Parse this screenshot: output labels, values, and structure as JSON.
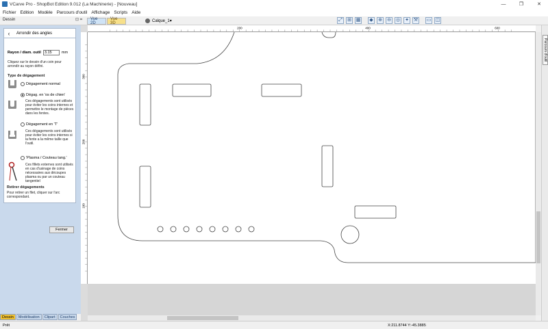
{
  "window": {
    "title": "VCarve Pro - ShopBot Edition 9.012 (La Machinerie) - [Nouveau]",
    "controls": [
      "—",
      "❐",
      "✕"
    ]
  },
  "menu": [
    "Fichier",
    "Edition",
    "Modèle",
    "Parcours d'outil",
    "Affichage",
    "Scripts",
    "Aide"
  ],
  "panel": {
    "header": "Dessin",
    "pin_glyph": "⊡ ⌗"
  },
  "view_tabs": {
    "tab2d": "Vue 2D",
    "tab3d": "Vue 3D"
  },
  "layer": {
    "label": "Calque_1",
    "arrow": "▾"
  },
  "card": {
    "title": "Arrondir des angles",
    "radius_label": "Rayon / diam. outil",
    "radius_value": "3.15",
    "radius_unit": "mm",
    "instruction": "Cliquez sur le dessin d'un coin pour arrondir au rayon défini.",
    "type_heading": "Type de dégagement",
    "options": [
      {
        "label": "Dégagement normal",
        "selected": false,
        "desc": ""
      },
      {
        "label": "Dégag. en 'os de chien'",
        "selected": true,
        "desc": "Ces dégagements sont utilisés pour éviter les coins internes et permettre le montage de pièces dans les fentes."
      },
      {
        "label": "Dégagement en 'T'",
        "selected": false,
        "desc": "Ces dégagements sont utilisés pour éviter les coins internes si la fente a la même taille que l'outil."
      },
      {
        "label": "'Plasma / Couteau tang.'",
        "selected": false,
        "desc": "Ces fillets externes sont utilisés en cas d'usinage de coins nécessaires aux découpes plasma ou par un couteau tangentiel"
      }
    ],
    "remove_heading": "Retirer dégagements",
    "remove_text": "Pour retirer un filet, cliquer sur l'arc correspondant.",
    "close_button": "Fermer"
  },
  "bottom_tabs": [
    "Dessin",
    "Modélisation",
    "Clipart",
    "Couches"
  ],
  "ruler": {
    "h_labels": [
      "200",
      "400",
      "600"
    ],
    "v_labels": [
      "300",
      "200",
      "100"
    ]
  },
  "right_strip": {
    "label": "Parcours d'outil"
  },
  "status": {
    "text": "Prêt",
    "coords": "X:211.8744 Y:-45.3885"
  },
  "colors": {
    "panel_bg": "#c9d9ec",
    "active_tab": "#f2c230",
    "tab2d": "#cfe3f6",
    "tab3d": "#f7e08a"
  }
}
